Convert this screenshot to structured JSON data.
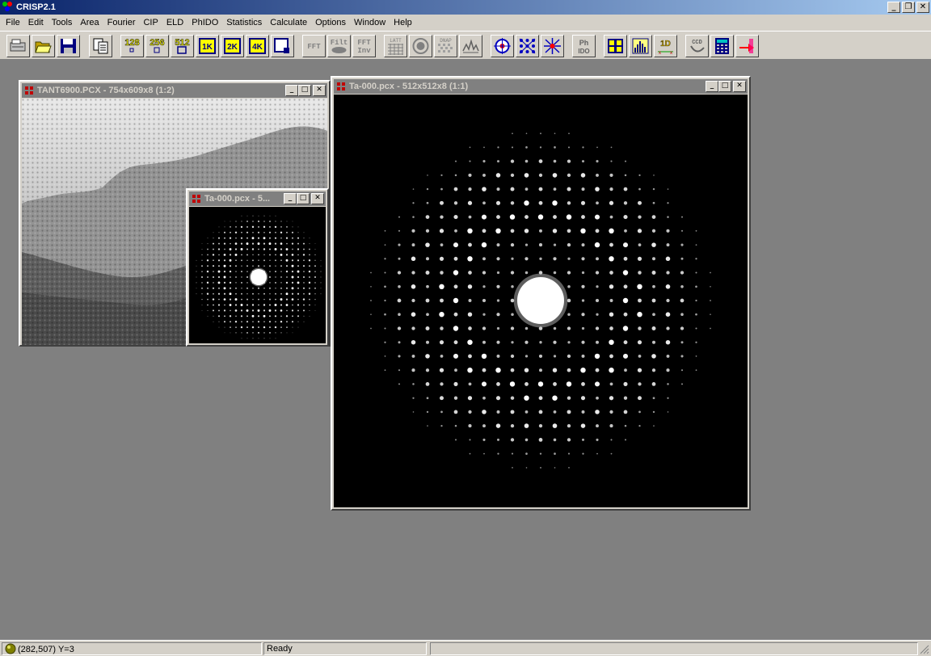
{
  "app": {
    "title": "CRISP2.1"
  },
  "caption_buttons": {
    "minimize": "_",
    "restore": "❐",
    "close": "✕"
  },
  "menu": [
    "File",
    "Edit",
    "Tools",
    "Area",
    "Fourier",
    "CIP",
    "ELD",
    "PhIDO",
    "Statistics",
    "Calculate",
    "Options",
    "Window",
    "Help"
  ],
  "toolbar": {
    "size_labels": [
      "128",
      "256",
      "512",
      "1K",
      "2K",
      "4K"
    ],
    "fft_labels": [
      "FFT",
      "Filt",
      "FFT Inv"
    ],
    "latt_label": "LATT",
    "dnap_label": "DNAP",
    "phido_label": "Ph IDO",
    "oned_label": "1D",
    "ccd_label": "CCD"
  },
  "windows": {
    "tem_image": {
      "title": "TANT6900.PCX - 754x609x8 (1:2)"
    },
    "small_diffraction": {
      "title": "Ta-000.pcx - 5..."
    },
    "large_diffraction": {
      "title": "Ta-000.pcx - 512x512x8 (1:1)"
    }
  },
  "window_buttons": {
    "minimize": "_",
    "maximize": "□",
    "close": "✕"
  },
  "status": {
    "coords": "(282,507) Y=3",
    "message": "Ready",
    "extra": ""
  },
  "colors": {
    "desktop": "#808080",
    "face": "#d4d0c8",
    "title_active_start": "#0a246a",
    "title_active_end": "#a6caf0",
    "inactive_title": "#808080",
    "icon_red": "#c00000"
  }
}
